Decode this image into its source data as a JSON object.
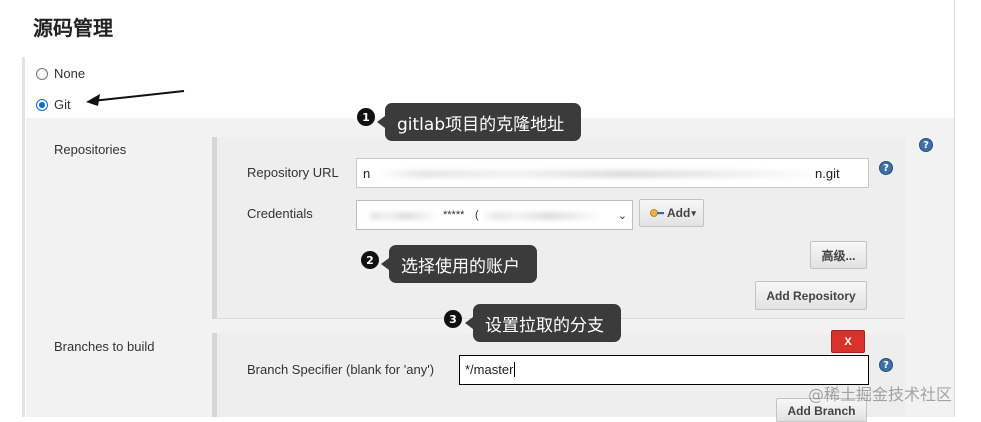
{
  "section": {
    "title": "源码管理"
  },
  "scm_options": {
    "none_label": "None",
    "git_label": "Git",
    "selected": "Git"
  },
  "repositories": {
    "label": "Repositories",
    "url_label": "Repository URL",
    "url_value_start": "n",
    "url_value_end": "n.git",
    "credentials_label": "Credentials",
    "credentials_value_mid": "*****",
    "credentials_value_paren": "(",
    "add_button_label": "Add",
    "advanced_button_label": "高级...",
    "add_repository_label": "Add Repository"
  },
  "branches": {
    "label": "Branches to build",
    "specifier_label": "Branch Specifier (blank for 'any')",
    "specifier_value": "*/master",
    "delete_label": "X",
    "add_branch_label": "Add Branch"
  },
  "help_icon_glyph": "?",
  "annotations": [
    {
      "number": "1",
      "text": "gitlab项目的克隆地址"
    },
    {
      "number": "2",
      "text": "选择使用的账户"
    },
    {
      "number": "3",
      "text": "设置拉取的分支"
    }
  ],
  "watermark": "@稀土掘金技术社区",
  "colors": {
    "radio_accent": "#0a6ad8",
    "help_icon": "#3f6fa6",
    "delete_button": "#d9322b",
    "callout_bg": "#3b3b3b"
  }
}
